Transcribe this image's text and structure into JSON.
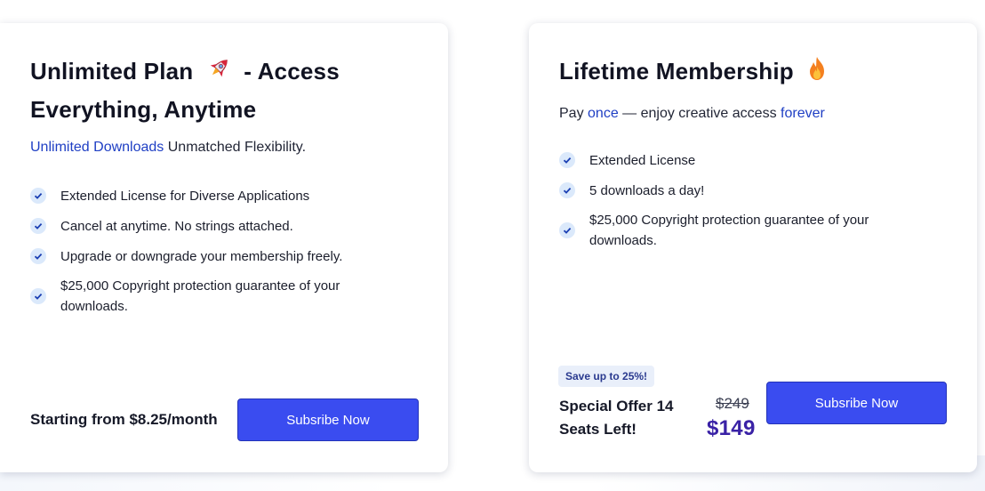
{
  "colors": {
    "accent_text": "#1f3fc4",
    "button": "#3a4cf0",
    "check_bg": "#dbe9fb",
    "check_mark": "#1b3fb3",
    "new_price": "#3a22a6"
  },
  "unlimited": {
    "title_part1": "Unlimited Plan",
    "title_icon": "rocket-icon",
    "title_part2": "- Access",
    "title_line2": "Everything, Anytime",
    "subtitle_accent": "Unlimited Downloads",
    "subtitle_rest": " Unmatched Flexibility.",
    "features": [
      "Extended License for Diverse Applications",
      "Cancel at anytime. No strings attached.",
      "Upgrade or downgrade your membership freely.",
      "$25,000 Copyright protection guarantee of your downloads."
    ],
    "price_note": "Starting from $8.25/month",
    "button_label": "Subsribe Now"
  },
  "lifetime": {
    "title": "Lifetime Membership",
    "title_icon": "fire-icon",
    "subtitle_pay": "Pay ",
    "subtitle_once": "once",
    "subtitle_mid": " — enjoy creative access ",
    "subtitle_forever": "forever",
    "features": [
      "Extended License",
      "5 downloads a day!",
      "$25,000 Copyright protection guarantee of your downloads."
    ],
    "badge": "Save up to 25%!",
    "offer_line1": "Special Offer 14",
    "offer_line2": "Seats Left!",
    "old_price": "$249",
    "new_price": "$149",
    "button_label": "Subsribe Now"
  }
}
